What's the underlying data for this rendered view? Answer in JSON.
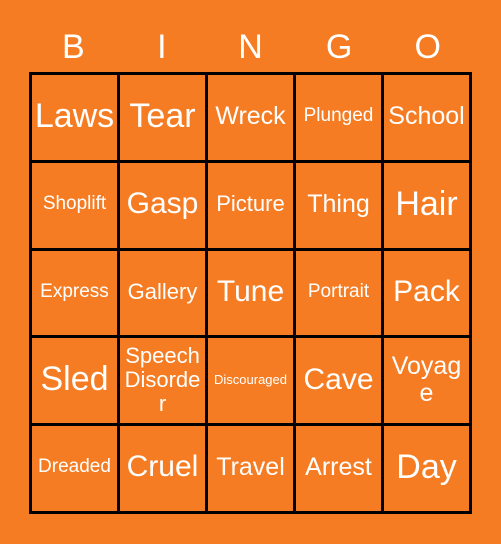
{
  "card": {
    "title": "BINGO",
    "background_color": "#f57c22",
    "border_color": "#000000",
    "text_color": "#ffffff"
  },
  "header": {
    "letters": [
      "B",
      "I",
      "N",
      "G",
      "O"
    ]
  },
  "grid": {
    "columns": 5,
    "rows": 5,
    "cells": [
      [
        {
          "text": "Laws",
          "size": "fs-xl"
        },
        {
          "text": "Tear",
          "size": "fs-xl"
        },
        {
          "text": "Wreck",
          "size": "fs-md"
        },
        {
          "text": "Plunged",
          "size": "fs-xs"
        },
        {
          "text": "School",
          "size": "fs-md"
        }
      ],
      [
        {
          "text": "Shoplift",
          "size": "fs-xs"
        },
        {
          "text": "Gasp",
          "size": "fs-lg"
        },
        {
          "text": "Picture",
          "size": "fs-sm"
        },
        {
          "text": "Thing",
          "size": "fs-md"
        },
        {
          "text": "Hair",
          "size": "fs-xl"
        }
      ],
      [
        {
          "text": "Express",
          "size": "fs-xs"
        },
        {
          "text": "Gallery",
          "size": "fs-sm"
        },
        {
          "text": "Tune",
          "size": "fs-lg"
        },
        {
          "text": "Portrait",
          "size": "fs-xs"
        },
        {
          "text": "Pack",
          "size": "fs-lg"
        }
      ],
      [
        {
          "text": "Sled",
          "size": "fs-xl"
        },
        {
          "text": "Speech Disorder",
          "size": "fs-sm"
        },
        {
          "text": "Discouraged",
          "size": "fs-xxs"
        },
        {
          "text": "Cave",
          "size": "fs-lg"
        },
        {
          "text": "Voyage",
          "size": "fs-md"
        }
      ],
      [
        {
          "text": "Dreaded",
          "size": "fs-xs"
        },
        {
          "text": "Cruel",
          "size": "fs-lg"
        },
        {
          "text": "Travel",
          "size": "fs-md"
        },
        {
          "text": "Arrest",
          "size": "fs-md"
        },
        {
          "text": "Day",
          "size": "fs-xl"
        }
      ]
    ]
  }
}
